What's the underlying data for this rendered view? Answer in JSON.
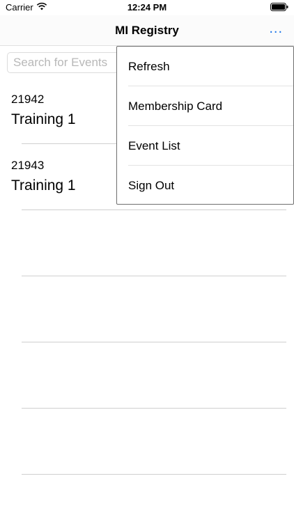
{
  "status_bar": {
    "carrier": "Carrier",
    "time": "12:24 PM"
  },
  "nav": {
    "title": "MI Registry",
    "more_label": "..."
  },
  "search": {
    "placeholder": "Search for Events"
  },
  "events": [
    {
      "id": "21942",
      "title": "Training 1"
    },
    {
      "id": "21943",
      "title": "Training 1"
    }
  ],
  "menu": {
    "items": [
      {
        "label": "Refresh"
      },
      {
        "label": "Membership Card"
      },
      {
        "label": "Event List"
      },
      {
        "label": "Sign Out"
      }
    ]
  },
  "colors": {
    "accent": "#1a73e8",
    "separator": "#cfcfcf"
  }
}
